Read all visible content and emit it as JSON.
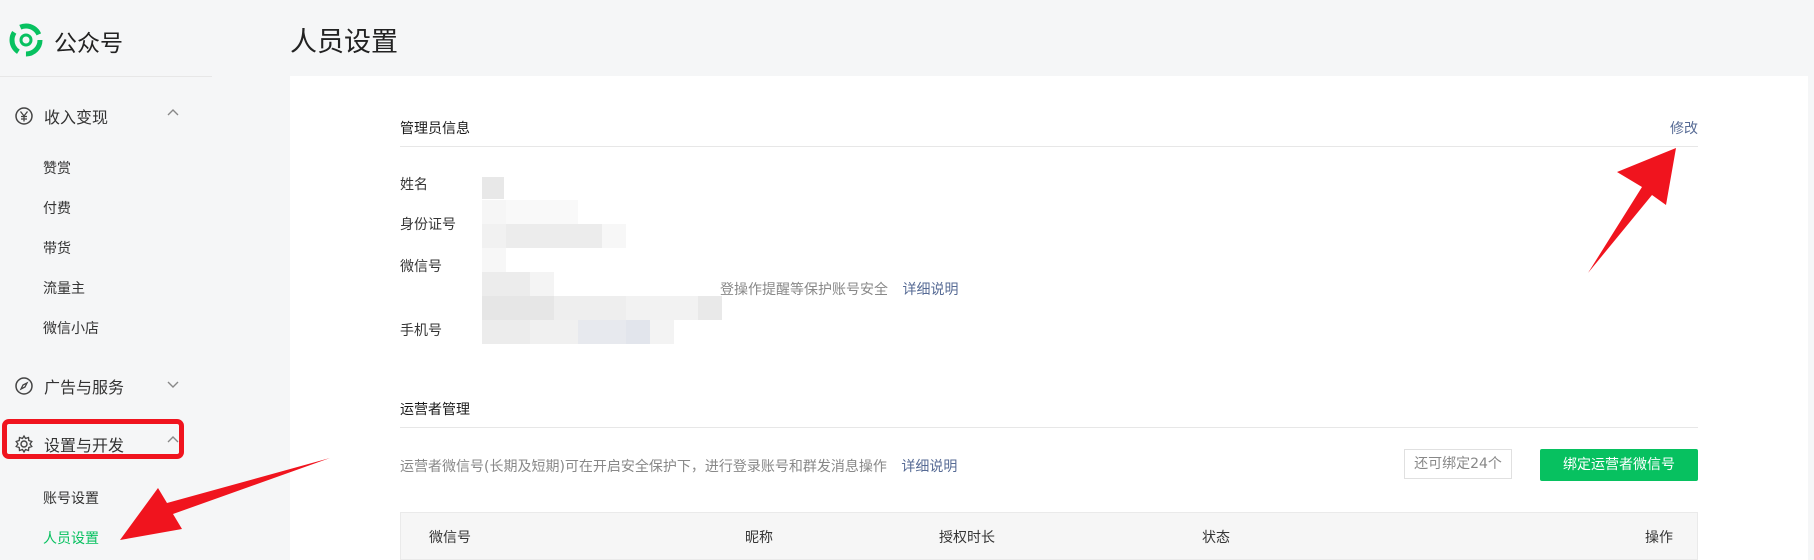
{
  "app": {
    "brand": "公众号",
    "page_title": "人员设置"
  },
  "sidebar": {
    "groups": [
      {
        "label": "收入变现",
        "icon": "yen-circle-icon",
        "expanded": true,
        "items": [
          "赞赏",
          "付费",
          "带货",
          "流量主",
          "微信小店"
        ]
      },
      {
        "label": "广告与服务",
        "icon": "compass-icon",
        "expanded": false,
        "items": []
      },
      {
        "label": "设置与开发",
        "icon": "gear-icon",
        "expanded": true,
        "items": [
          "账号设置",
          "人员设置"
        ],
        "active_item": "人员设置"
      }
    ]
  },
  "admin": {
    "title": "管理员信息",
    "edit_link": "修改",
    "fields": {
      "name_label": "姓名",
      "id_label": "身份证号",
      "wechat_label": "微信号",
      "phone_label": "手机号"
    },
    "wechat_hint": "登操作提醒等保护账号安全",
    "wechat_detail_link": "详细说明"
  },
  "operators": {
    "title": "运营者管理",
    "hint": "运营者微信号(长期及短期)可在开启安全保护下，进行登录账号和群发消息操作",
    "detail_link": "详细说明",
    "remaining": "还可绑定24个",
    "bind_button": "绑定运营者微信号",
    "table_headers": [
      "微信号",
      "昵称",
      "授权时长",
      "状态",
      "操作"
    ]
  },
  "colors": {
    "accent": "#07c160",
    "link": "#576b95",
    "annotation": "#f0141e"
  }
}
